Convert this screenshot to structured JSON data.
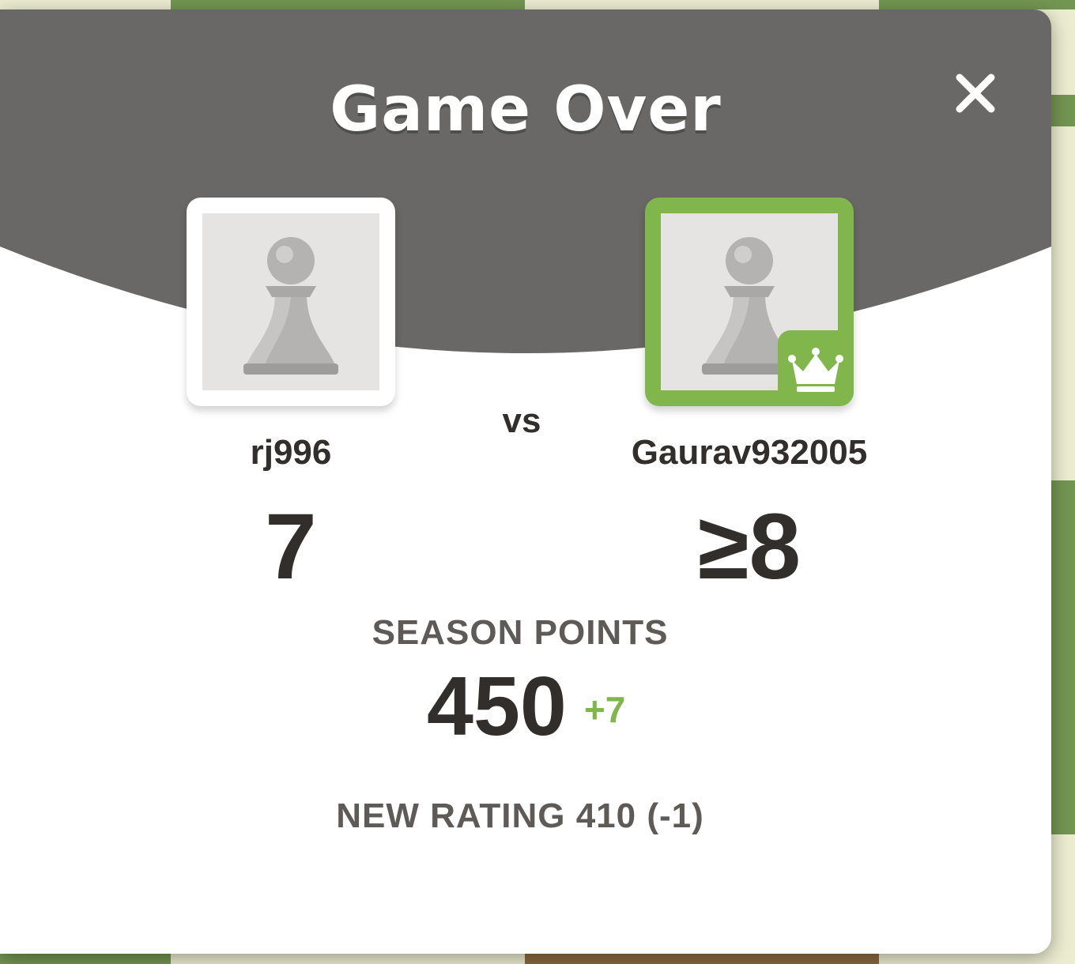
{
  "modal": {
    "title": "Game Over",
    "close_icon": "close-icon"
  },
  "players": {
    "left": {
      "username": "rj996",
      "avatar_icon": "pawn-icon",
      "score": "7"
    },
    "vs_label": "vs",
    "right": {
      "username": "Gaurav932005",
      "avatar_icon": "pawn-icon",
      "winner_badge_icon": "crown-icon",
      "score": "≥8"
    }
  },
  "season": {
    "label": "SEASON POINTS",
    "value": "450",
    "delta": "+7"
  },
  "rating": {
    "text": "NEW RATING 410 (-1)"
  },
  "colors": {
    "header": "#696866",
    "accent_green": "#81b64c",
    "text_dark": "#312e2b",
    "text_muted": "#5d5a57",
    "board_light": "#ebecd0",
    "board_dark": "#739552"
  }
}
